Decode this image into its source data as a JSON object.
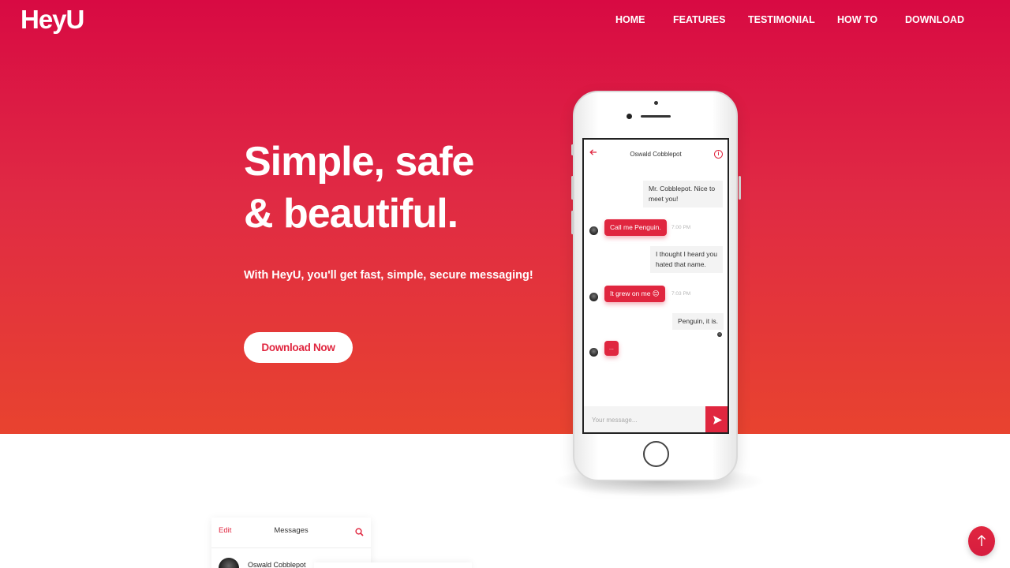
{
  "brand": {
    "logo": "HeyU"
  },
  "nav": {
    "items": [
      {
        "label": "HOME"
      },
      {
        "label": "FEATURES"
      },
      {
        "label": "TESTIMONIAL"
      },
      {
        "label": "HOW TO"
      },
      {
        "label": "DOWNLOAD"
      }
    ]
  },
  "hero": {
    "title_line1": "Simple, safe",
    "title_line2": "& beautiful.",
    "subtitle": "With HeyU, you'll get fast, simple, secure messaging!",
    "cta_label": "Download Now"
  },
  "chat": {
    "contact_name": "Oswald Cobblepot",
    "info_icon": "info-icon",
    "back_icon": "arrow-left-icon",
    "messages": [
      {
        "direction": "out",
        "text_line1": "Mr. Cobblepot. Nice to",
        "text_line2": "meet you!"
      },
      {
        "direction": "in",
        "text": "Call me Penguin.",
        "time": "7:00 PM"
      },
      {
        "direction": "out",
        "text_line1": "I thought I heard you",
        "text_line2": "hated that name."
      },
      {
        "direction": "in",
        "text": "It grew on me 😊",
        "time": "7:03 PM"
      },
      {
        "direction": "out",
        "text": "Penguin, it is."
      },
      {
        "direction": "in",
        "text": "..."
      }
    ],
    "composer_placeholder": "Your message...",
    "send_icon": "send-icon"
  },
  "messages_panel": {
    "edit_label": "Edit",
    "title": "Messages",
    "search_icon": "search-icon",
    "first_contact": "Oswald Cobblepot"
  },
  "scroll_top_icon": "arrow-up-icon",
  "colors": {
    "accent": "#e0263f",
    "hero_top": "#d80a43",
    "hero_bottom": "#e8432f"
  }
}
